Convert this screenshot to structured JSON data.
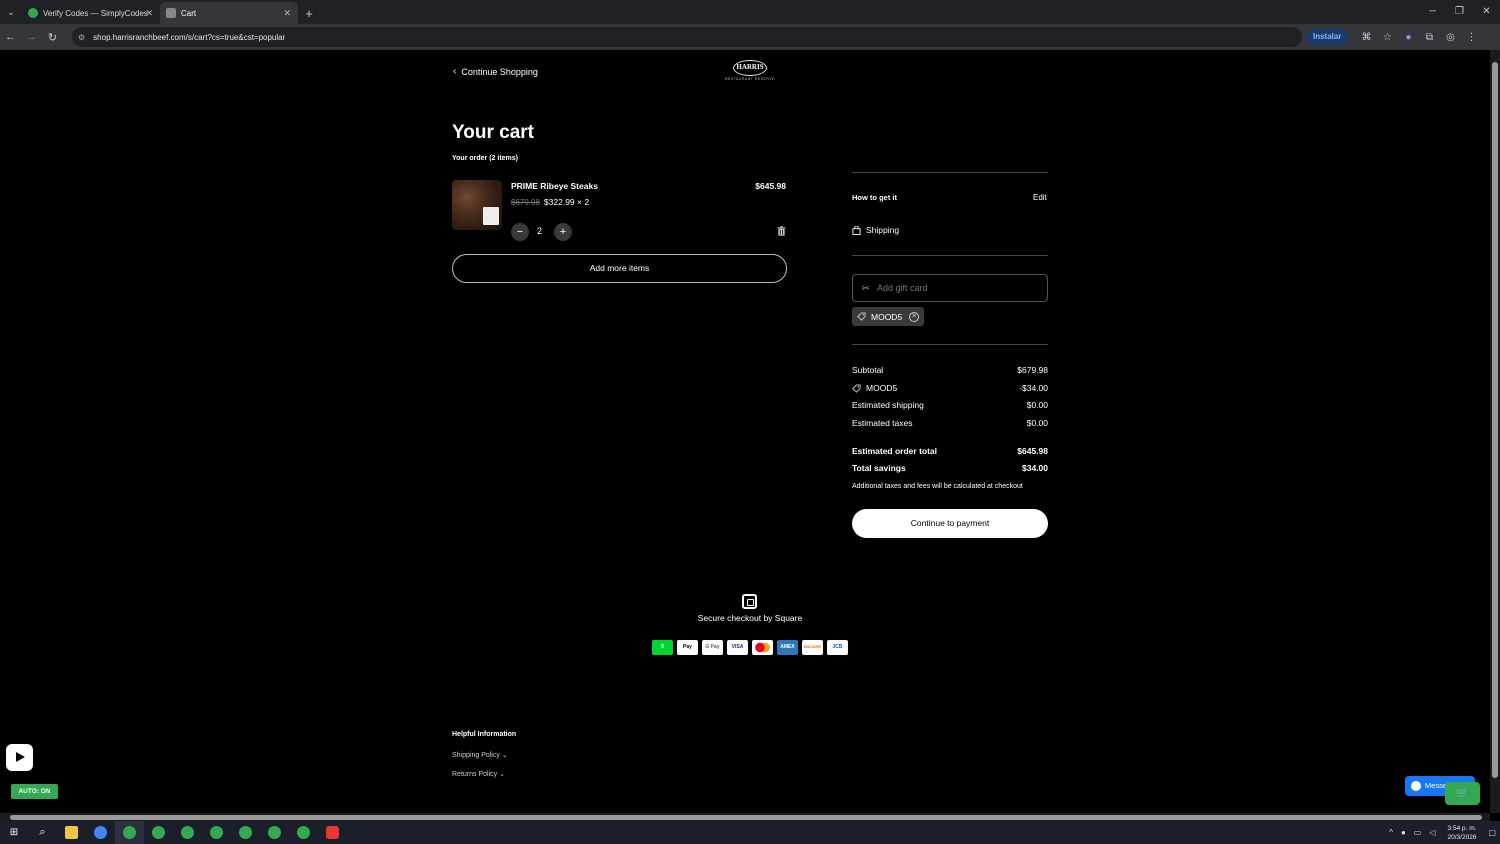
{
  "browser": {
    "tabs": [
      {
        "title": "Verify Codes — SimplyCodes",
        "active": false
      },
      {
        "title": "Cart",
        "active": true
      }
    ],
    "url": "shop.harrisranchbeef.com/s/cart?cs=true&cst=popular",
    "install_label": "Instalar"
  },
  "colors": {
    "accent_green": "#34a853",
    "messenger_blue": "#1877f2",
    "background": "#000000"
  },
  "header": {
    "continue_label": "Continue Shopping",
    "logo_text": "HARRIS",
    "logo_sub": "RESTAURANT RESERVE"
  },
  "cart": {
    "title": "Your cart",
    "order_count": "Your order (2 items)",
    "items": [
      {
        "name": "PRIME Ribeye Steaks",
        "old_price": "$679.98",
        "unit_price": "$322.99 × 2",
        "total": "$645.98",
        "quantity": "2",
        "icons": {
          "minus": "minus-icon",
          "plus": "plus-icon",
          "remove": "trash-icon"
        }
      }
    ],
    "add_more_label": "Add more items"
  },
  "summary": {
    "how_label": "How to get it",
    "edit_label": "Edit",
    "shipping_label": "Shipping",
    "gift_placeholder": "Add gift card",
    "promo_code": "MOOD5",
    "lines": [
      {
        "label": "Subtotal",
        "value": "$679.98"
      },
      {
        "label": "MOOD5",
        "value": "-$34.00"
      },
      {
        "label": "Estimated shipping",
        "value": "$0.00"
      },
      {
        "label": "Estimated taxes",
        "value": "$0.00"
      }
    ],
    "totals": [
      {
        "label": "Estimated order total",
        "value": "$645.98"
      },
      {
        "label": "Total savings",
        "value": "$34.00"
      }
    ],
    "note": "Additional taxes and fees will be calculated at checkout",
    "pay_label": "Continue to payment"
  },
  "footer": {
    "secure_label": "Secure checkout by Square",
    "payment_methods": [
      {
        "name": "Cash App",
        "text": "$",
        "bg": "#00d632",
        "fg": "#ffffff"
      },
      {
        "name": "Apple Pay",
        "text": "Pay",
        "bg": "#ffffff",
        "fg": "#000000"
      },
      {
        "name": "Google Pay",
        "text": "G Pay",
        "bg": "#ffffff",
        "fg": "#5f6368"
      },
      {
        "name": "Visa",
        "text": "VISA",
        "bg": "#ffffff",
        "fg": "#1a1f71"
      },
      {
        "name": "Mastercard",
        "text": "",
        "bg": "#ffffff",
        "fg": "#eb001b"
      },
      {
        "name": "American Express",
        "text": "AMEX",
        "bg": "#2e77bc",
        "fg": "#ffffff"
      },
      {
        "name": "Discover",
        "text": "DISCOVER",
        "bg": "#ffffff",
        "fg": "#e65c00"
      },
      {
        "name": "JCB",
        "text": "JCB",
        "bg": "#ffffff",
        "fg": "#0b5fa5"
      }
    ],
    "helpful_title": "Helpful Information",
    "policies": [
      "Shipping Policy",
      "Returns Policy"
    ]
  },
  "overlays": {
    "auto_badge": "AUTO: ON",
    "messenger_label": "Messenger"
  },
  "taskbar": {
    "time": "3:54 p. m.",
    "date": "20/3/2026"
  }
}
